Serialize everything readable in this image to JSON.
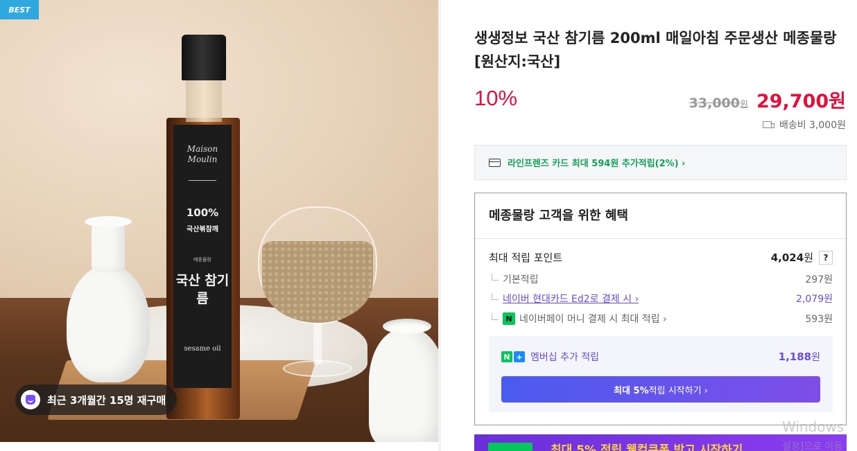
{
  "badge": {
    "best": "BEST"
  },
  "product_image": {
    "bottle_brand": "Maison Moulin",
    "bottle_percent": "100%",
    "bottle_small": "국산볶참깨",
    "bottle_tiny": "메종물랑",
    "bottle_name": "국산 참기름",
    "bottle_eng": "sesame oil"
  },
  "repurchase": {
    "text": "최근 3개월간 15명 재구매"
  },
  "product": {
    "title": "생생정보 국산 참기름 200ml 매일아침 주문생산 메종물랑 [원산지:국산]",
    "discount": "10%",
    "original_price": "33,000",
    "original_won": "원",
    "sale_price": "29,700원",
    "shipping": "배송비 3,000원"
  },
  "card_benefit": {
    "text": "라인프렌즈 카드 최대 594원 추가적립(2%) ›"
  },
  "benefit": {
    "heading": "메종물랑 고객을 위한 혜택",
    "max_points_label": "최대 적립 포인트",
    "max_points_value": "4,024",
    "won": "원",
    "help": "?",
    "rows": [
      {
        "label": "기본적립",
        "value": "297원"
      },
      {
        "label": "네이버 현대카드 Ed2로 결제 시 ›",
        "value": "2,079원"
      },
      {
        "label": "네이버페이 머니 결제 시 최대 적립 ›",
        "value": "593원"
      }
    ],
    "npay_icon": "N",
    "membership_label": "멤버십 추가 적립",
    "membership_value": "1,188",
    "nplus_n": "N",
    "nplus_plus": "+",
    "membership_button_prefix": "최대 5%",
    "membership_button_suffix": " 적립 시작하기 ›"
  },
  "promo_banner": {
    "text": "최대 5% 적립 웰컴쿠폰 받고 시작하기"
  },
  "watermark": {
    "line1": "Windows",
    "line2": "설정]으로 이동"
  },
  "colors": {
    "accent_red": "#e0123d",
    "green": "#16a05a",
    "purple": "#6a4ce0",
    "best_blue": "#2fa8e0"
  }
}
